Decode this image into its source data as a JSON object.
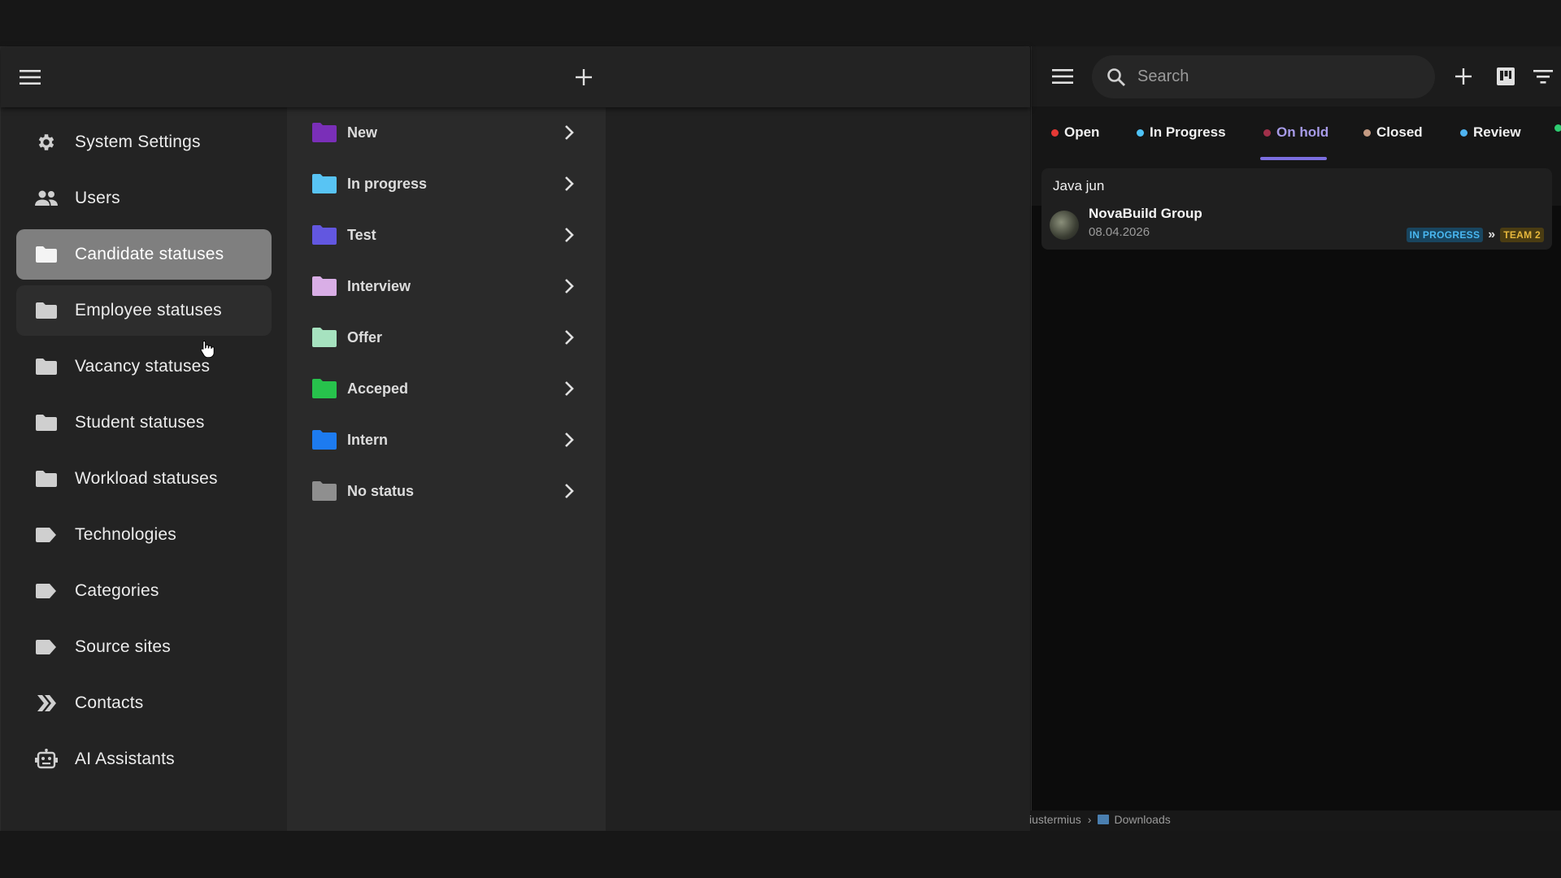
{
  "left_app": {
    "header": {
      "menu_icon": "menu-icon",
      "add_icon": "plus-icon"
    },
    "sidebar": {
      "items": [
        {
          "label": "System Settings",
          "icon": "gear-icon"
        },
        {
          "label": "Users",
          "icon": "users-icon"
        },
        {
          "label": "Candidate statuses",
          "icon": "folder-icon",
          "state": "selected"
        },
        {
          "label": "Employee statuses",
          "icon": "folder-icon",
          "state": "hover"
        },
        {
          "label": "Vacancy statuses",
          "icon": "folder-icon"
        },
        {
          "label": "Student statuses",
          "icon": "folder-icon"
        },
        {
          "label": "Workload statuses",
          "icon": "folder-icon"
        },
        {
          "label": "Technologies",
          "icon": "tag-icon"
        },
        {
          "label": "Categories",
          "icon": "tag-icon"
        },
        {
          "label": "Source sites",
          "icon": "tag-icon"
        },
        {
          "label": "Contacts",
          "icon": "double-chevron-icon"
        },
        {
          "label": "AI Assistants",
          "icon": "robot-icon"
        }
      ]
    },
    "statuses": [
      {
        "label": "New",
        "color": "#7a2fb8"
      },
      {
        "label": "In progress",
        "color": "#58c4f4"
      },
      {
        "label": "Test",
        "color": "#6257e0"
      },
      {
        "label": "Interview",
        "color": "#d9aee6"
      },
      {
        "label": "Offer",
        "color": "#a6e2bf"
      },
      {
        "label": "Acceped",
        "color": "#27c24c"
      },
      {
        "label": "Intern",
        "color": "#1d7bf0"
      },
      {
        "label": "No status",
        "color": "#8f8f8f"
      }
    ]
  },
  "right_panel": {
    "search": {
      "placeholder": "Search"
    },
    "tabs": [
      {
        "label": "Open",
        "dot": "#e53935"
      },
      {
        "label": "In Progress",
        "dot": "#4fc3f7"
      },
      {
        "label": "On hold",
        "dot": "#a0304a",
        "active": true
      },
      {
        "label": "Closed",
        "dot": "#c49a82"
      },
      {
        "label": "Review",
        "dot": "#4fb3f0"
      },
      {
        "label": "",
        "dot": "#2ecc71"
      }
    ],
    "card": {
      "title": "Java jun",
      "company": "NovaBuild Group",
      "date": "08.04.2026",
      "status_badge": "IN PROGRESS",
      "arrow": "»",
      "team_badge": "TEAM 2"
    }
  },
  "breadcrumb": {
    "part1": "iustermius",
    "separator": "›",
    "part2": "Downloads"
  }
}
